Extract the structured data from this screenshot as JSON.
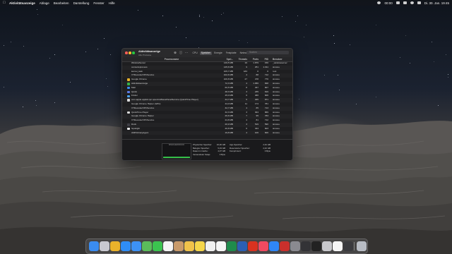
{
  "menubar": {
    "items": [
      "Aktivitätsanzeige",
      "Ablage",
      "Bearbeiten",
      "Darstellung",
      "Fenster",
      "Hilfe"
    ],
    "clock": "Di. 30. Jan. 19:45",
    "battery": "00:00"
  },
  "window": {
    "title": "Aktivitätsanzeige",
    "subtitle": "Alle Prozesse",
    "tabs": [
      "CPU",
      "Speicher",
      "Energie",
      "Festplatte",
      "Netzwerk"
    ],
    "active_tab": "Speicher",
    "search_placeholder": "Suchen"
  },
  "table": {
    "columns": [
      "Prozessname",
      "Spei...",
      "Threads",
      "Ports",
      "PID",
      "Benutzer"
    ],
    "rows": [
      {
        "name": "WindowServer",
        "mem": "149,5 MB",
        "threads": "19",
        "ports": "1.879",
        "pid": "156",
        "user": "_windowserver",
        "icon": "none",
        "color": ""
      },
      {
        "name": "contentsprocess",
        "mem": "145,6 MB",
        "threads": "9",
        "ports": "251",
        "pid": "1.011",
        "user": "simone",
        "icon": "none",
        "color": ""
      },
      {
        "name": "kernel_task",
        "mem": "105,7 MB",
        "threads": "183",
        "ports": "0",
        "pid": "0",
        "user": "root",
        "icon": "none",
        "color": ""
      },
      {
        "name": "VTDecoderXPCService",
        "mem": "102,6 MB",
        "threads": "4",
        "ports": "88",
        "pid": "712",
        "user": "simone",
        "icon": "none",
        "color": ""
      },
      {
        "name": "Google Chrome",
        "mem": "100,8 MB",
        "threads": "27",
        "ports": "478",
        "pid": "776",
        "user": "simone",
        "icon": "chrome-icon",
        "color": "#e9b22b"
      },
      {
        "name": "Aktivitätsanzeige",
        "mem": "72,3 MB",
        "threads": "4",
        "ports": "1.056",
        "pid": "828",
        "user": "simone",
        "icon": "activity-monitor-icon",
        "color": "#37b34a"
      },
      {
        "name": "Mail",
        "mem": "60,5 MB",
        "threads": "8",
        "ports": "457",
        "pid": "807",
        "user": "simone",
        "icon": "mail-icon",
        "color": "#3a8cf0"
      },
      {
        "name": "Quick",
        "mem": "48,3 MB",
        "threads": "3",
        "ports": "235",
        "pid": "819",
        "user": "simone",
        "icon": "quick-icon",
        "color": "#5b7de8"
      },
      {
        "name": "Finder",
        "mem": "45,0 MB",
        "threads": "6",
        "ports": "460",
        "pid": "606",
        "user": "simone",
        "icon": "finder-icon",
        "color": "#4aa3f0"
      },
      {
        "name": "com.apple.appkit.xpc.openAndSavePanelService (QuickTime Player)",
        "mem": "44,7 MB",
        "threads": "5",
        "ports": "295",
        "pid": "871",
        "user": "simone",
        "icon": "quicktime-icon",
        "color": "#dcdcdc"
      },
      {
        "name": "Google Chrome Helper (GPU)",
        "mem": "44,0 MB",
        "threads": "11",
        "ports": "174",
        "pid": "781",
        "user": "simone",
        "icon": "none",
        "color": ""
      },
      {
        "name": "VTDecoderXPCService",
        "mem": "32,7 MB",
        "threads": "4",
        "ports": "85",
        "pid": "713",
        "user": "simone",
        "icon": "none",
        "color": ""
      },
      {
        "name": "QuickTime Player",
        "mem": "32,3 MB",
        "threads": "3",
        "ports": "304",
        "pid": "869",
        "user": "simone",
        "icon": "quicktime-player-icon",
        "color": "#d9d9d9"
      },
      {
        "name": "Google Chrome Helper",
        "mem": "26,6 MB",
        "threads": "7",
        "ports": "95",
        "pid": "783",
        "user": "simone",
        "icon": "none",
        "color": ""
      },
      {
        "name": "VTDecoderXPCService",
        "mem": "24,8 MB",
        "threads": "4",
        "ports": "81",
        "pid": "712",
        "user": "simone",
        "icon": "none",
        "color": ""
      },
      {
        "name": "Dock",
        "mem": "20,9 MB",
        "threads": "3",
        "ports": "519",
        "pid": "590",
        "user": "simone",
        "icon": "dock-app-icon",
        "color": "#3f3f46"
      },
      {
        "name": "Spotlight",
        "mem": "20,8 MB",
        "threads": "6",
        "ports": "334",
        "pid": "603",
        "user": "simone",
        "icon": "spotlight-icon",
        "color": "#f2f2f2"
      },
      {
        "name": "AMPLibraryAgent",
        "mem": "19,8 MB",
        "threads": "4",
        "ports": "106",
        "pid": "606",
        "user": "simone",
        "icon": "none",
        "color": ""
      }
    ]
  },
  "footer": {
    "pressure_title": "SPEICHERDRUCK",
    "pressure_color": "#36c04a",
    "left_stats": [
      {
        "label": "Physischer Speicher:",
        "value": "16,00 GB"
      },
      {
        "label": "Belegter Speicher:",
        "value": "5,33 GB"
      },
      {
        "label": "Daten im Cache:",
        "value": "4,37 GB"
      },
      {
        "label": "Verwendeter Swap:",
        "value": "0 Byte"
      }
    ],
    "right_stats": [
      {
        "label": "App-Speicher:",
        "value": "2,91 GB"
      },
      {
        "label": "Reservierter Speicher:",
        "value": "2,42 GB"
      },
      {
        "label": "Komprimiert:",
        "value": "0 Byte"
      }
    ]
  },
  "dock": {
    "apps": [
      {
        "name": "finder-icon",
        "color": "#3a8cf0"
      },
      {
        "name": "launchpad-icon",
        "color": "#c8c8d0"
      },
      {
        "name": "chrome-icon",
        "color": "#e9b22b"
      },
      {
        "name": "safari-icon",
        "color": "#2f8df5"
      },
      {
        "name": "mail-icon",
        "color": "#3d92f5"
      },
      {
        "name": "maps-icon",
        "color": "#5bbd5b"
      },
      {
        "name": "facetime-icon",
        "color": "#3bc34f"
      },
      {
        "name": "calendar-icon",
        "color": "#f4f4f4"
      },
      {
        "name": "contacts-icon",
        "color": "#c89a6a"
      },
      {
        "name": "photos-icon",
        "color": "#f0c24a"
      },
      {
        "name": "notes-icon",
        "color": "#f5d64a"
      },
      {
        "name": "reminders-icon",
        "color": "#f0f0f0"
      },
      {
        "name": "freeform-icon",
        "color": "#f5f5f5"
      },
      {
        "name": "excel-icon",
        "color": "#1f8b4c"
      },
      {
        "name": "word-icon",
        "color": "#2b5fb4"
      },
      {
        "name": "acrobat-icon",
        "color": "#d9321f"
      },
      {
        "name": "music-icon",
        "color": "#f04a60"
      },
      {
        "name": "appstore-icon",
        "color": "#2f86f6"
      },
      {
        "name": "photo-booth-icon",
        "color": "#c9302c"
      },
      {
        "name": "system-settings-icon",
        "color": "#8a8a90"
      },
      {
        "name": "activity-monitor-icon",
        "color": "#333336"
      },
      {
        "name": "terminal-icon",
        "color": "#222"
      },
      {
        "name": "screenshot-icon",
        "color": "#c8c8cc"
      },
      {
        "name": "font-book-icon",
        "color": "#f5f5f5"
      },
      {
        "name": "quicktime-icon",
        "color": "#3a3a3e"
      },
      {
        "name": "trash-icon",
        "color": "#b8bcc4"
      }
    ]
  }
}
